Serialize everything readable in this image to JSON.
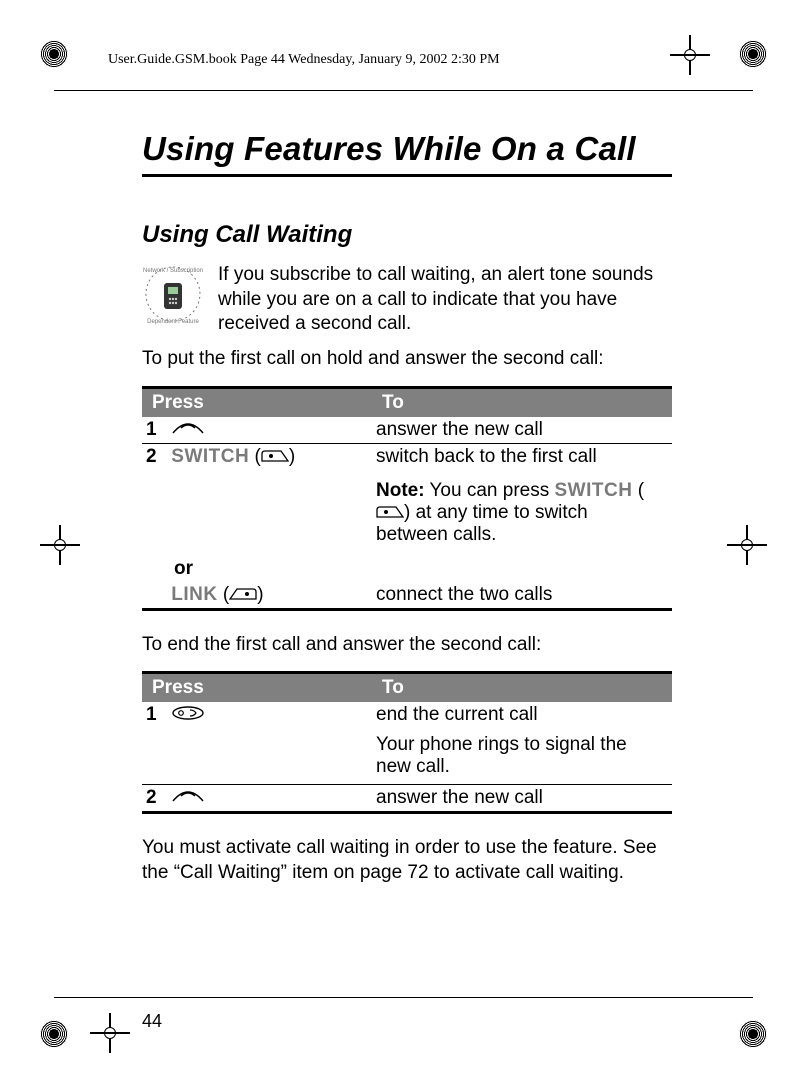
{
  "running_head": "User.Guide.GSM.book  Page 44  Wednesday, January 9, 2002  2:30 PM",
  "page_number": "44",
  "chapter_title": "Using Features While On a Call",
  "section_title": "Using Call Waiting",
  "intro_paragraph": "If you subscribe to call waiting, an alert tone sounds while you are on a call to indicate that you have received a second call.",
  "lead_in_1": "To put the first call on hold and answer the second call:",
  "lead_in_2": "To end the first call and answer the second call:",
  "closing_paragraph": "You must activate call waiting in order to use the feature. See the “Call Waiting” item on page 72 to activate call waiting.",
  "headers": {
    "press": "Press",
    "to": "To"
  },
  "labels": {
    "switch": "SWITCH",
    "link": "LINK",
    "or": "or",
    "note": "Note:"
  },
  "table1": {
    "row1_to": "answer the new call",
    "row2_to_a": "switch back to the first call",
    "row2_note": "You can press ",
    "row2_note_tail": " at any time to switch between calls.",
    "row2b_to": "connect the two calls"
  },
  "table2": {
    "row1_to_a": "end the current call",
    "row1_to_b": "Your phone rings to signal the new call.",
    "row2_to": "answer the new call"
  },
  "icons": {
    "send_key": "send-key-icon",
    "end_key": "end-key-icon",
    "softkey_left": "softkey-left-icon",
    "softkey_right": "softkey-right-icon",
    "network_feature": "network-feature-icon"
  }
}
